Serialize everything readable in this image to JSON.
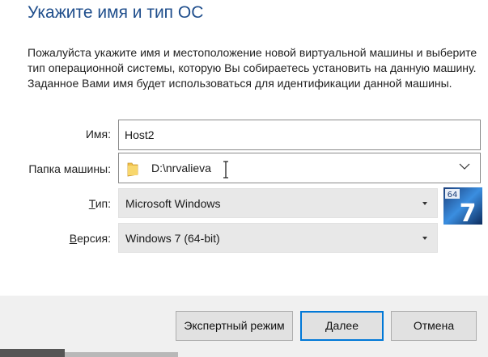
{
  "page": {
    "title": "Укажите имя и тип ОС",
    "description": "Пожалуйста укажите имя и местоположение новой виртуальной машины и выберите тип операционной системы, которую Вы собираетесь установить на данную машину. Заданное Вами имя будет использоваться для идентификации данной машины."
  },
  "form": {
    "name_label": "Имя:",
    "name_value": "Host2",
    "folder_label": "Папка машины:",
    "folder_value": "D:\\nrvalieva",
    "type_label_first": "Т",
    "type_label_rest": "ип:",
    "type_value": "Microsoft Windows",
    "version_label_first": "В",
    "version_label_rest": "ерсия:",
    "version_value": "Windows 7 (64-bit)"
  },
  "os_icon": {
    "badge": "64",
    "digit": "7",
    "icon": "windows-7-64-icon"
  },
  "buttons": {
    "expert": "Экспертный режим",
    "next": "Далее",
    "cancel": "Отмена"
  },
  "colors": {
    "title": "#1f4e8c",
    "default_button_border": "#0078d7",
    "footer_bg": "#f0f0f0"
  }
}
